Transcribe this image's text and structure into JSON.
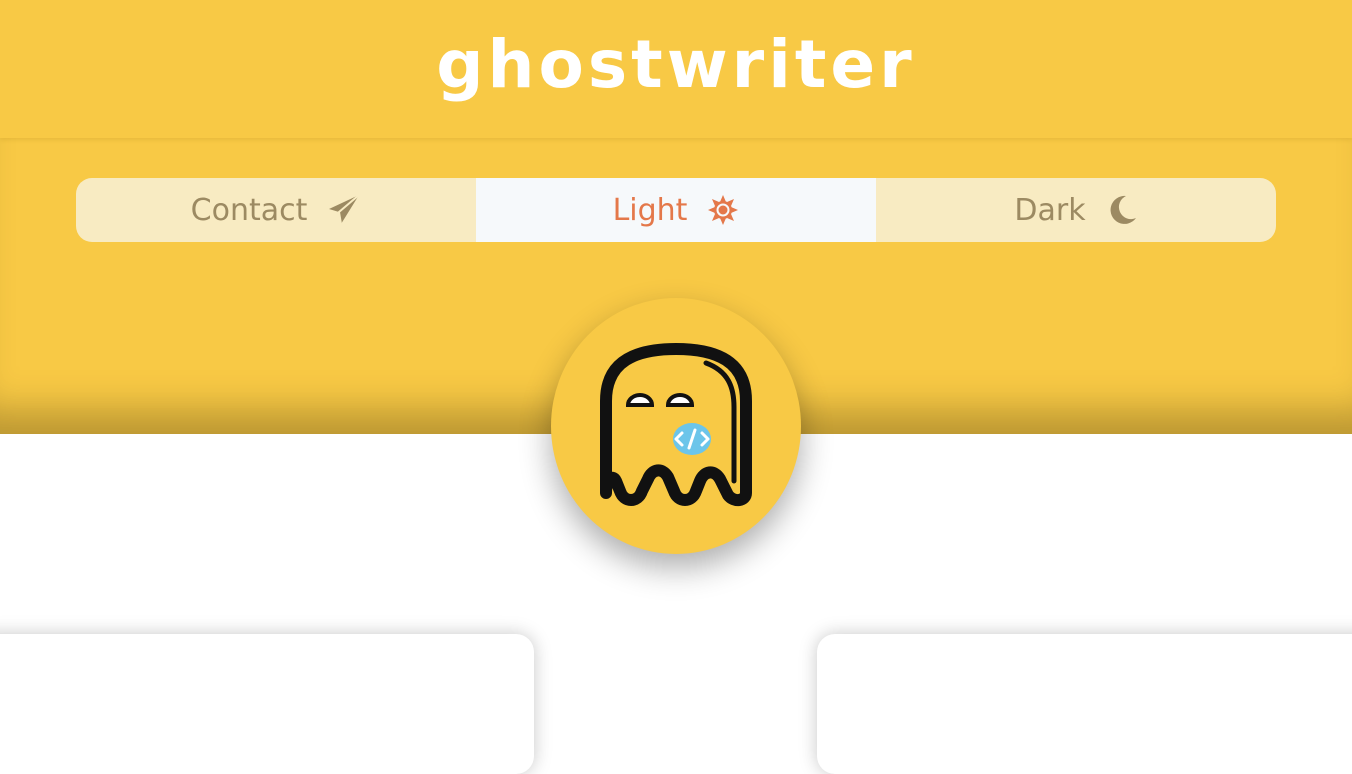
{
  "header": {
    "title": "ghostwriter"
  },
  "nav": {
    "items": [
      {
        "label": "Contact",
        "icon": "paper-plane-icon",
        "active": false
      },
      {
        "label": "Light",
        "icon": "sun-icon",
        "active": true
      },
      {
        "label": "Dark",
        "icon": "moon-icon",
        "active": false
      }
    ]
  },
  "avatar": {
    "icon": "ghost-code-logo"
  },
  "colors": {
    "brand_yellow": "#f8c945",
    "tab_inactive_bg": "#f8ebc2",
    "tab_inactive_text": "#9c8a62",
    "tab_active_bg": "#f6f9fb",
    "tab_active_text": "#e4784a",
    "code_badge": "#6cc5ea"
  }
}
